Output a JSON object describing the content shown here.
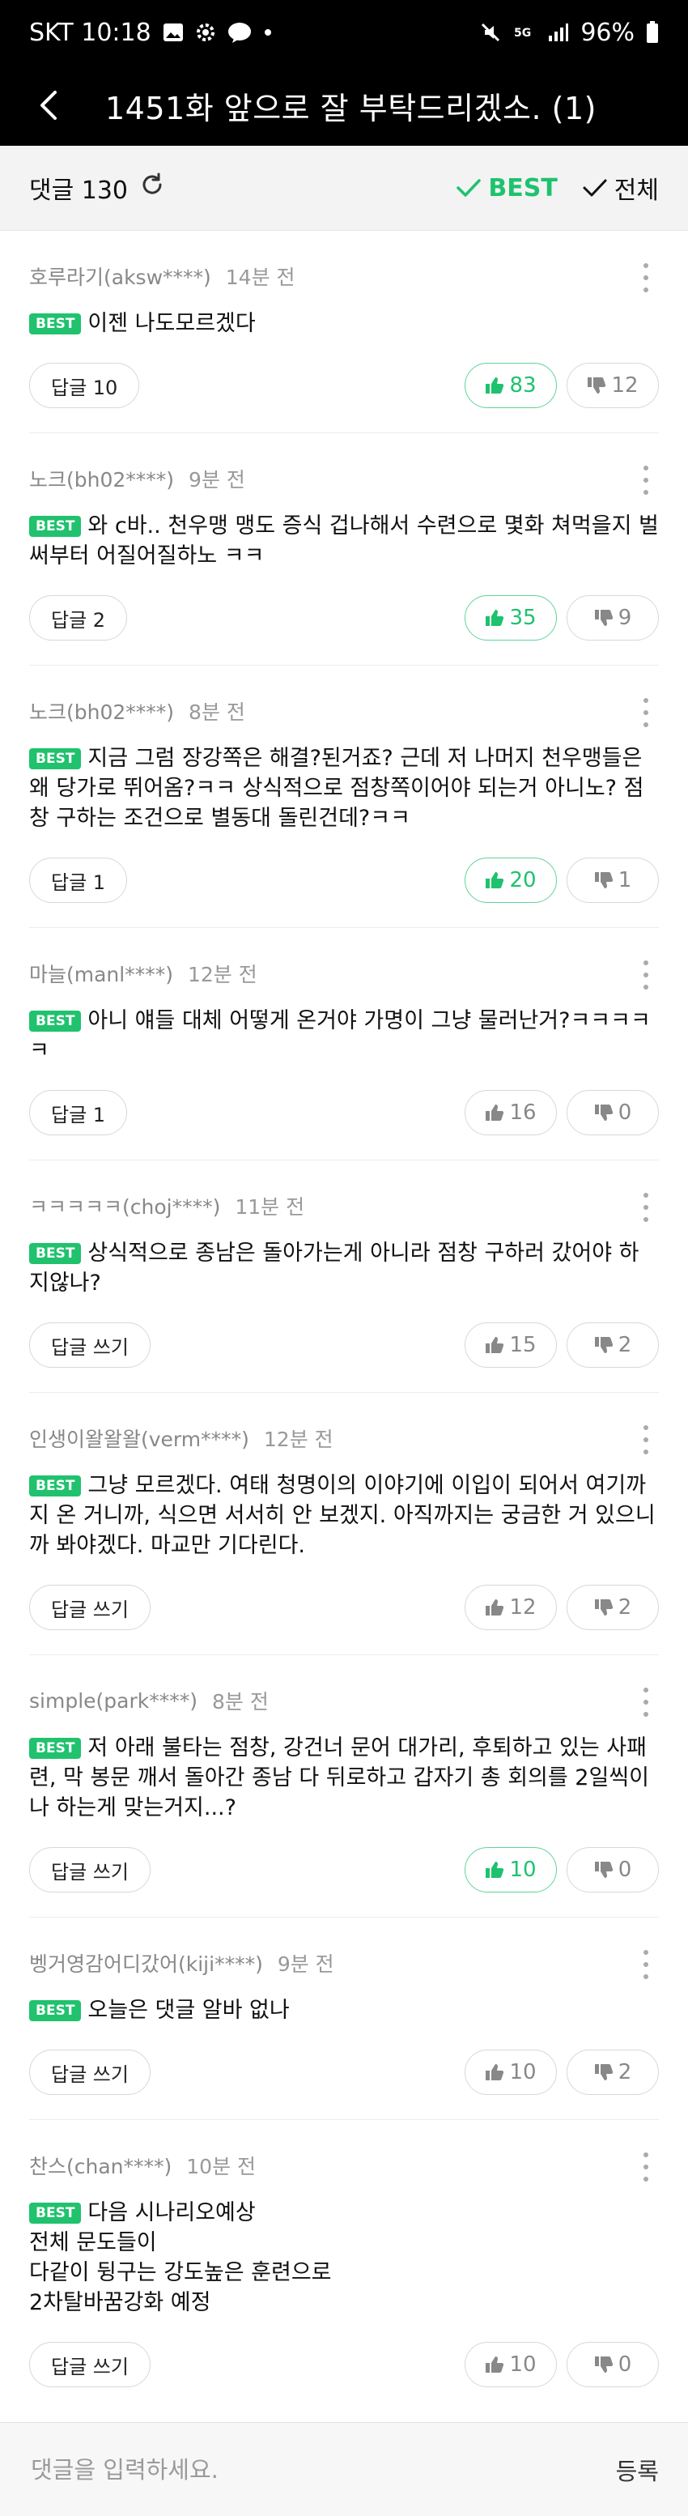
{
  "statusbar": {
    "carrier_time": "SKT 10:18",
    "battery": "96%"
  },
  "appbar": {
    "title": "1451화 앞으로 잘 부탁드리겠소. (1)"
  },
  "countbar": {
    "label": "댓글 130",
    "best": "BEST",
    "all": "전체"
  },
  "colors": {
    "accent": "#1ec26e",
    "badge": "#20c26d"
  },
  "comments": [
    {
      "author": "호루라기(aksw****)",
      "time": "14분 전",
      "badge": "BEST",
      "text": "이젠 나도모르겠다",
      "reply": "답글 10",
      "up": "83",
      "down": "12",
      "up_hi": true
    },
    {
      "author": "노크(bh02****)",
      "time": "9분 전",
      "badge": "BEST",
      "text": "와 c바.. 천우맹 맹도 증식 겁나해서 수련으로 몇화 쳐먹을지 벌써부터 어질어질하노 ㅋㅋ",
      "reply": "답글 2",
      "up": "35",
      "down": "9",
      "up_hi": true
    },
    {
      "author": "노크(bh02****)",
      "time": "8분 전",
      "badge": "BEST",
      "text": "지금 그럼 장강쪽은 해결?된거죠? 근데 저 나머지 천우맹들은 왜 당가로 뛰어옴?ㅋㅋ 상식적으로 점창쪽이어야 되는거 아니노? 점창 구하는 조건으로 별동대 돌린건데?ㅋㅋ",
      "reply": "답글 1",
      "up": "20",
      "down": "1",
      "up_hi": true
    },
    {
      "author": "마늘(manl****)",
      "time": "12분 전",
      "badge": "BEST",
      "text": "아니 얘들 대체 어떻게 온거야 가명이 그냥 물러난거?ㅋㅋㅋㅋㅋ",
      "reply": "답글 1",
      "up": "16",
      "down": "0",
      "up_hi": false
    },
    {
      "author": "ㅋㅋㅋㅋㅋ(choj****)",
      "time": "11분 전",
      "badge": "BEST",
      "text": "상식적으로 종남은 돌아가는게 아니라 점창 구하러 갔어야 하지않나?",
      "reply": "답글 쓰기",
      "up": "15",
      "down": "2",
      "up_hi": false
    },
    {
      "author": "인생이왈왈왈(verm****)",
      "time": "12분 전",
      "badge": "BEST",
      "text": "그냥 모르겠다. 여태 청명이의 이야기에 이입이 되어서 여기까지 온 거니까, 식으면 서서히 안 보겠지. 아직까지는 궁금한 거 있으니까 봐야겠다. 마교만 기다린다.",
      "reply": "답글 쓰기",
      "up": "12",
      "down": "2",
      "up_hi": false
    },
    {
      "author": "simple(park****)",
      "time": "8분 전",
      "badge": "BEST",
      "text": "저 아래 불타는 점창, 강건너 문어 대가리, 후퇴하고 있는 사패련, 막 봉문 깨서 돌아간 종남 다 뒤로하고 갑자기 총 회의를 2일씩이나 하는게 맞는거지...?",
      "reply": "답글 쓰기",
      "up": "10",
      "down": "0",
      "up_hi": true
    },
    {
      "author": "벵거영감어디갔어(kiji****)",
      "time": "9분 전",
      "badge": "BEST",
      "text": "오늘은 댓글 알바 없나",
      "reply": "답글 쓰기",
      "up": "10",
      "down": "2",
      "up_hi": false
    },
    {
      "author": "찬스(chan****)",
      "time": "10분 전",
      "badge": "BEST",
      "text": "다음 시나리오예상\n전체 문도들이\n다같이 뒹구는 강도높은 훈련으로\n2차탈바꿈강화 예정",
      "reply": "답글 쓰기",
      "up": "10",
      "down": "0",
      "up_hi": false
    }
  ],
  "input": {
    "placeholder": "댓글을 입력하세요.",
    "submit": "등록"
  }
}
